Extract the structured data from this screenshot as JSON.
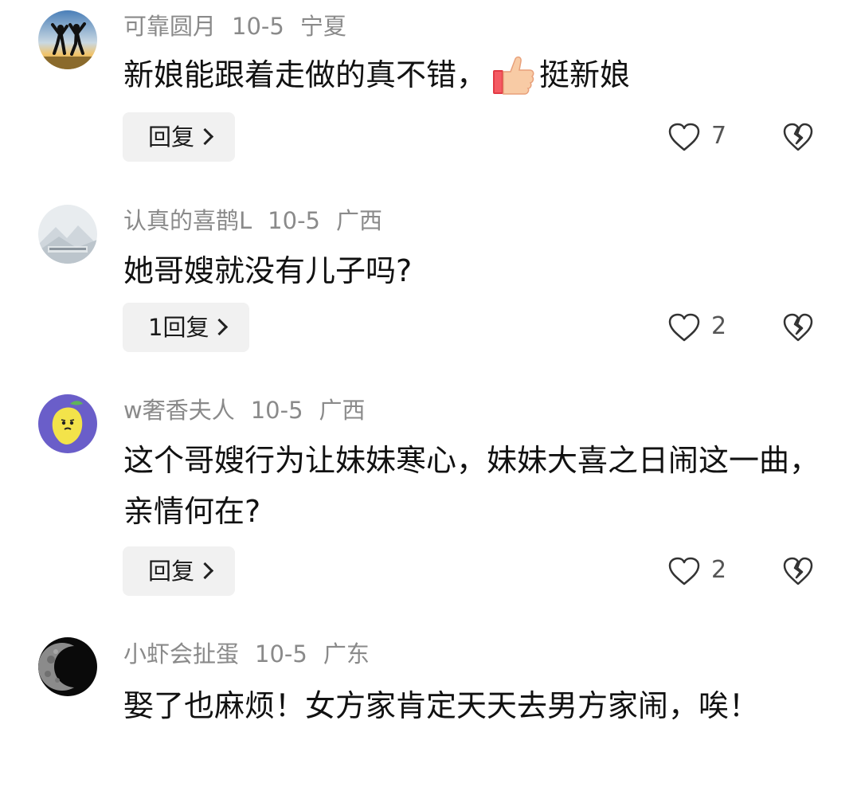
{
  "comments": [
    {
      "username": "可靠圆月",
      "date": "10-5",
      "location": "宁夏",
      "text_before": "新娘能跟着走做的真不错，",
      "emoji": "thumbs-up",
      "text_after": "挺新娘",
      "reply_label": "回复",
      "likes": "7"
    },
    {
      "username": "认真的喜鹊L",
      "date": "10-5",
      "location": "广西",
      "text": "她哥嫂就没有儿子吗?",
      "reply_label": "1回复",
      "likes": "2"
    },
    {
      "username": "w奢香夫人",
      "date": "10-5",
      "location": "广西",
      "text": "这个哥嫂行为让妹妹寒心，妹妹大喜之日闹这一曲，亲情何在?",
      "reply_label": "回复",
      "likes": "2"
    },
    {
      "username": "小虾会扯蛋",
      "date": "10-5",
      "location": "广东",
      "text": "娶了也麻烦！女方家肯定天天去男方家闹，唉！"
    }
  ],
  "icons": {
    "like": "heart-outline-icon",
    "dislike": "broken-heart-icon",
    "reply_chevron": "chevron-right-icon"
  }
}
